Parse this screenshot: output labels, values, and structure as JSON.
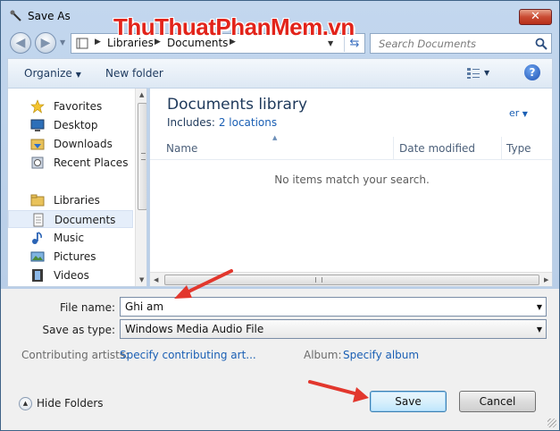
{
  "window": {
    "title": "Save As"
  },
  "address": {
    "crumbs": [
      "Libraries",
      "Documents"
    ],
    "search_placeholder": "Search Documents"
  },
  "toolbar": {
    "organize": "Organize",
    "new_folder": "New folder"
  },
  "nav": {
    "items": [
      {
        "label": "Favorites",
        "icon": "star-icon",
        "selected": false
      },
      {
        "label": "Desktop",
        "icon": "desktop-icon",
        "selected": false
      },
      {
        "label": "Downloads",
        "icon": "downloads-folder-icon",
        "selected": false
      },
      {
        "label": "Recent Places",
        "icon": "recent-places-icon",
        "selected": false
      },
      {
        "label": "Libraries",
        "icon": "libraries-icon",
        "selected": false
      },
      {
        "label": "Documents",
        "icon": "documents-icon",
        "selected": true
      },
      {
        "label": "Music",
        "icon": "music-icon",
        "selected": false
      },
      {
        "label": "Pictures",
        "icon": "pictures-icon",
        "selected": false
      },
      {
        "label": "Videos",
        "icon": "videos-icon",
        "selected": false
      }
    ]
  },
  "library": {
    "title": "Documents library",
    "includes_label": "Includes:",
    "includes_link": "2 locations",
    "arrange_fragment": "er"
  },
  "columns": [
    "Name",
    "Date modified",
    "Type"
  ],
  "empty_message": "No items match your search.",
  "watermark": "ThuThuatPhanMem.vn",
  "form": {
    "file_name_label": "File name:",
    "file_name_value": "Ghi am",
    "save_type_label": "Save as type:",
    "save_type_value": "Windows Media Audio File",
    "artists_label": "Contributing artists:",
    "artists_link": "Specify contributing art...",
    "album_label": "Album:",
    "album_link": "Specify album"
  },
  "footer": {
    "hide_folders": "Hide Folders",
    "save": "Save",
    "cancel": "Cancel"
  },
  "colors": {
    "link": "#1a5fb4",
    "annotation_arrow": "#e2372d",
    "watermark": "#e2231a"
  }
}
